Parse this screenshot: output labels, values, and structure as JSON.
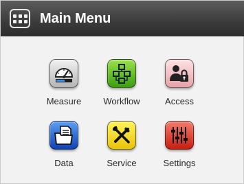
{
  "header": {
    "title": "Main Menu",
    "menu_icon": "grid-menu-icon"
  },
  "menu": {
    "items": [
      {
        "label": "Measure",
        "icon": "gauge-icon",
        "color": "#b5b5b5"
      },
      {
        "label": "Workflow",
        "icon": "workflow-icon",
        "color": "#3a9e12"
      },
      {
        "label": "Access",
        "icon": "user-lock-icon",
        "color": "#e6a2a8"
      },
      {
        "label": "Data",
        "icon": "folder-document-icon",
        "color": "#1040b5"
      },
      {
        "label": "Service",
        "icon": "tools-icon",
        "color": "#e8c20a"
      },
      {
        "label": "Settings",
        "icon": "sliders-icon",
        "color": "#c81e10"
      }
    ]
  }
}
